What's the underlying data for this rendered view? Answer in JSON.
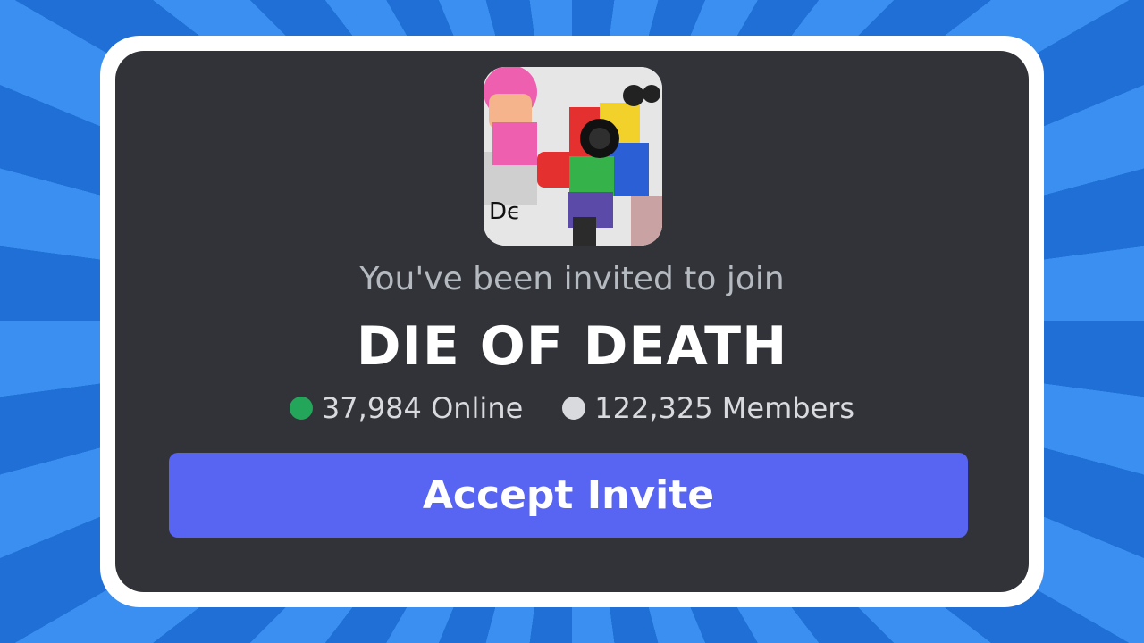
{
  "invite": {
    "intro_text": "You've been invited to join",
    "server_name": "DIE OF DEATH",
    "online_count": "37,984 Online",
    "member_count": "122,325 Members",
    "accept_label": "Accept Invite"
  },
  "icons": {
    "server_icon": "server-artwork-icon",
    "online_dot": "online-status-dot",
    "members_dot": "members-status-dot"
  },
  "colors": {
    "accent_button": "#5865f2",
    "online": "#23a55a",
    "members": "#d8dade",
    "card_background": "#313338"
  }
}
